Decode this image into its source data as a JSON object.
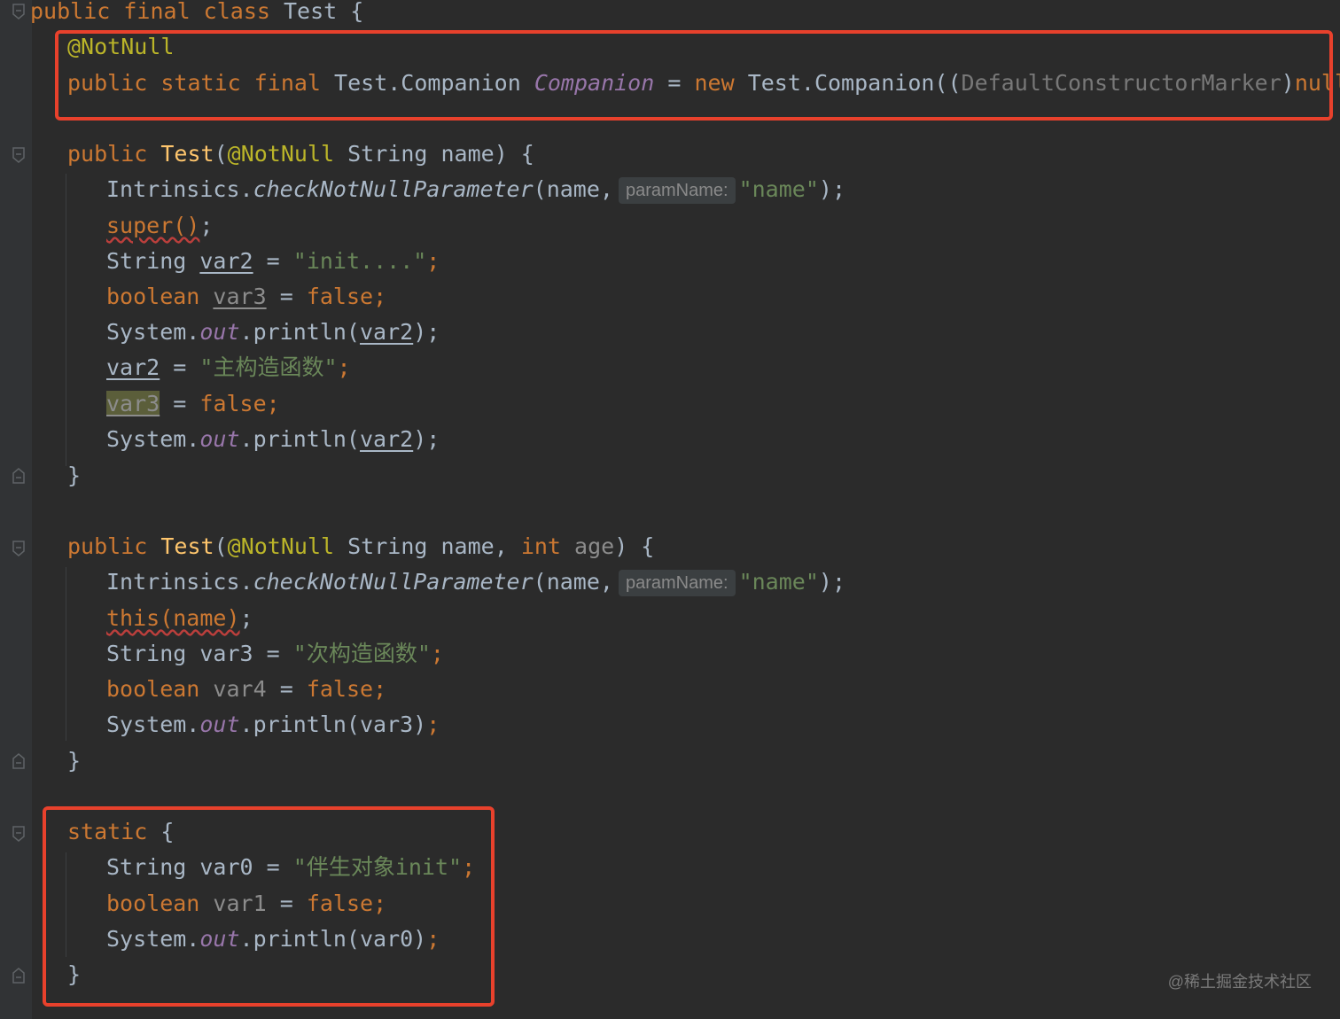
{
  "editor": {
    "class_decl": {
      "mods": "public final class",
      "name": "Test",
      "brace": "{"
    },
    "companion": {
      "annotation": "@NotNull",
      "mods": "public static final",
      "type": "Test.Companion",
      "name": "Companion",
      "assign": "=",
      "new_kw": "new",
      "ctor": "Test.Companion((",
      "cast": "DefaultConstructorMarker",
      "cast_close": ")",
      "null_kw": "null",
      "tail": ");"
    },
    "ctor1": {
      "public_kw": "public",
      "name": "Test",
      "open_paren": "(",
      "annotation": "@NotNull",
      "params": " String name) {",
      "check_prefix": "Intrinsics.",
      "check_method": "checkNotNullParameter",
      "check_args": "(name,",
      "hint": "paramName:",
      "check_str": "\"name\"",
      "check_tail": ");",
      "super_call": "super()",
      "super_tail": ";",
      "str_type": "String",
      "var2": "var2",
      "eq": "=",
      "init_str": "\"init....\"",
      "semi": ";",
      "bool_kw": "boolean",
      "var3": "var3",
      "false_kw": "false",
      "sys": "System.",
      "out": "out",
      "println": ".println(",
      "close": ");",
      "ctor_str": "\"主构造函数\"",
      "brace_close": "}"
    },
    "ctor2": {
      "public_kw": "public",
      "name": "Test",
      "open_paren": "(",
      "annotation": "@NotNull",
      "params_a": " String name,",
      "int_kw": "int",
      "age": "age",
      "params_b": ") {",
      "check_prefix": "Intrinsics.",
      "check_method": "checkNotNullParameter",
      "check_args": "(name,",
      "hint": "paramName:",
      "check_str": "\"name\"",
      "check_tail": ");",
      "this_call": "this(name)",
      "this_tail": ";",
      "str_type": "String",
      "var3": "var3",
      "eq": "=",
      "sec_str": "\"次构造函数\"",
      "semi": ";",
      "bool_kw": "boolean",
      "var4": "var4",
      "false_kw": "false",
      "sys": "System.",
      "out": "out",
      "println": ".println(var3)",
      "brace_close": "}"
    },
    "static_block": {
      "static_kw": "static",
      "brace_open": "{",
      "str_type": "String",
      "var0": "var0",
      "eq": "=",
      "companion_str": "\"伴生对象init\"",
      "semi": ";",
      "bool_kw": "boolean",
      "var1": "var1",
      "false_kw": "false",
      "sys": "System.",
      "out": "out",
      "println": ".println(var0)",
      "brace_close": "}"
    }
  },
  "watermark": "@稀土掘金技术社区",
  "colors": {
    "background": "#2b2b2b",
    "keyword": "#cc7832",
    "annotation": "#bbb529",
    "string": "#6a8759",
    "method_decl": "#ffc66d",
    "static_field": "#9876aa",
    "highlight_box": "#e8412c"
  }
}
